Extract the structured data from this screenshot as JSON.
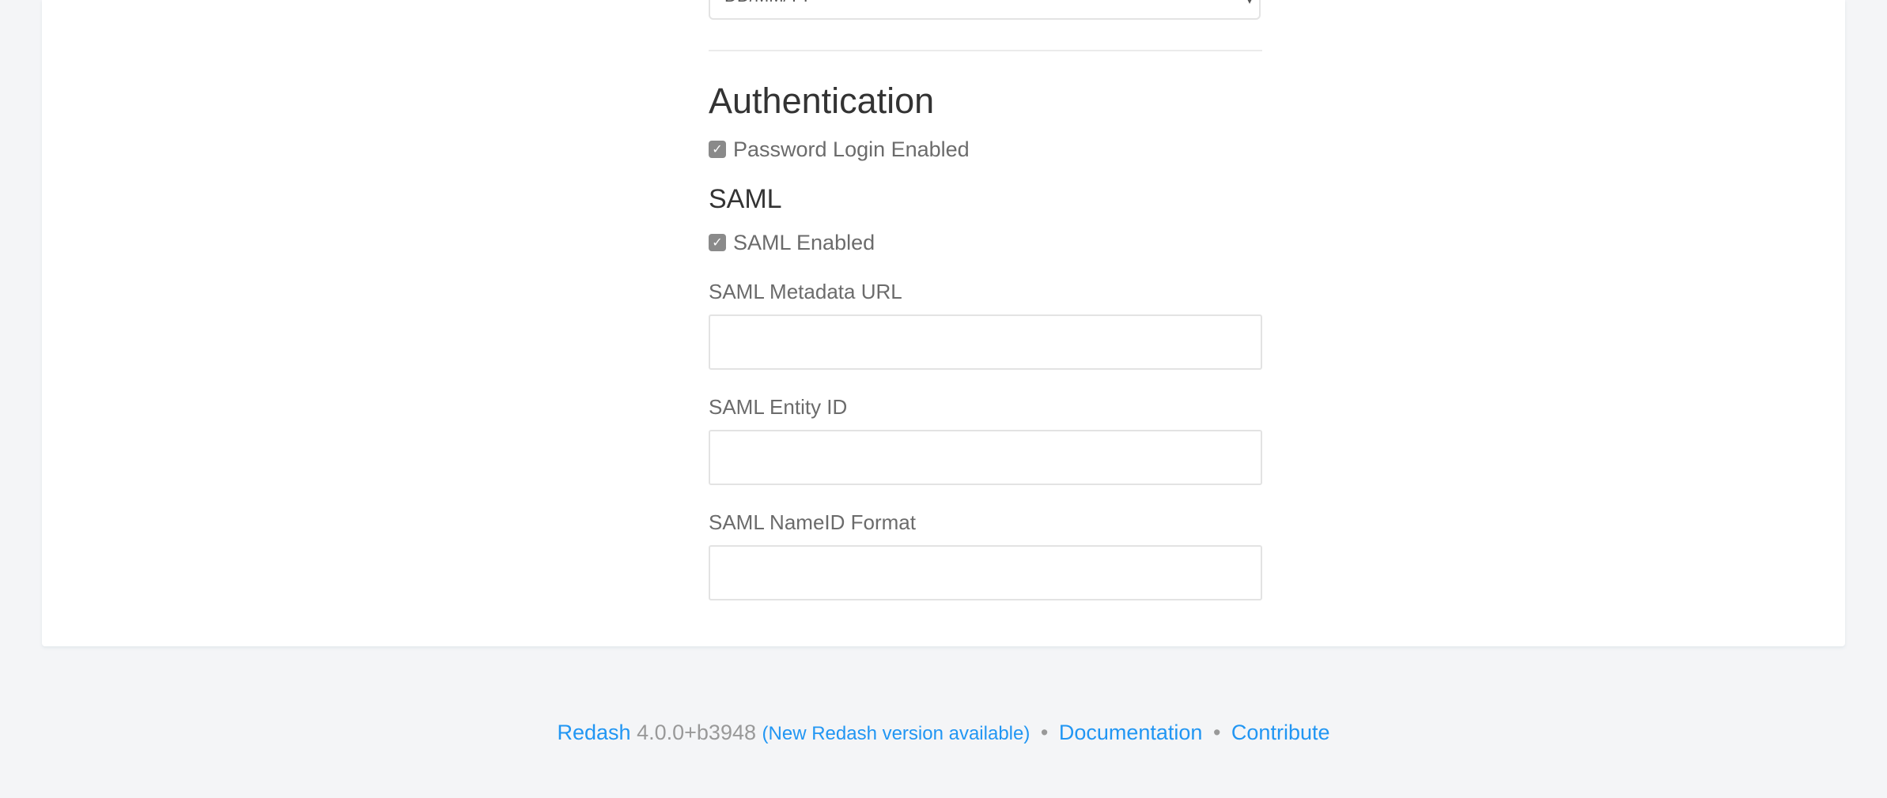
{
  "settings": {
    "date_format_select": {
      "value": "DD/MM/YY",
      "caret": "▾"
    },
    "authentication": {
      "title": "Authentication",
      "password_login": {
        "label": "Password Login Enabled",
        "checked": true,
        "check_glyph": "✓"
      }
    },
    "saml": {
      "title": "SAML",
      "enabled": {
        "label": "SAML Enabled",
        "checked": true,
        "check_glyph": "✓"
      },
      "metadata_url": {
        "label": "SAML Metadata URL",
        "value": ""
      },
      "entity_id": {
        "label": "SAML Entity ID",
        "value": ""
      },
      "nameid_format": {
        "label": "SAML NameID Format",
        "value": ""
      }
    }
  },
  "footer": {
    "brand": "Redash",
    "version": "4.0.0+b3948",
    "new_version": "(New Redash version available)",
    "separator": "•",
    "documentation": "Documentation",
    "contribute": "Contribute"
  },
  "colors": {
    "page_bg": "#f4f5f7",
    "card_bg": "#ffffff",
    "link": "#2196f3",
    "muted_text": "#999999",
    "label_text": "#6b6b6b",
    "heading_text": "#333333",
    "checkbox_fill": "#8a8a8a"
  }
}
